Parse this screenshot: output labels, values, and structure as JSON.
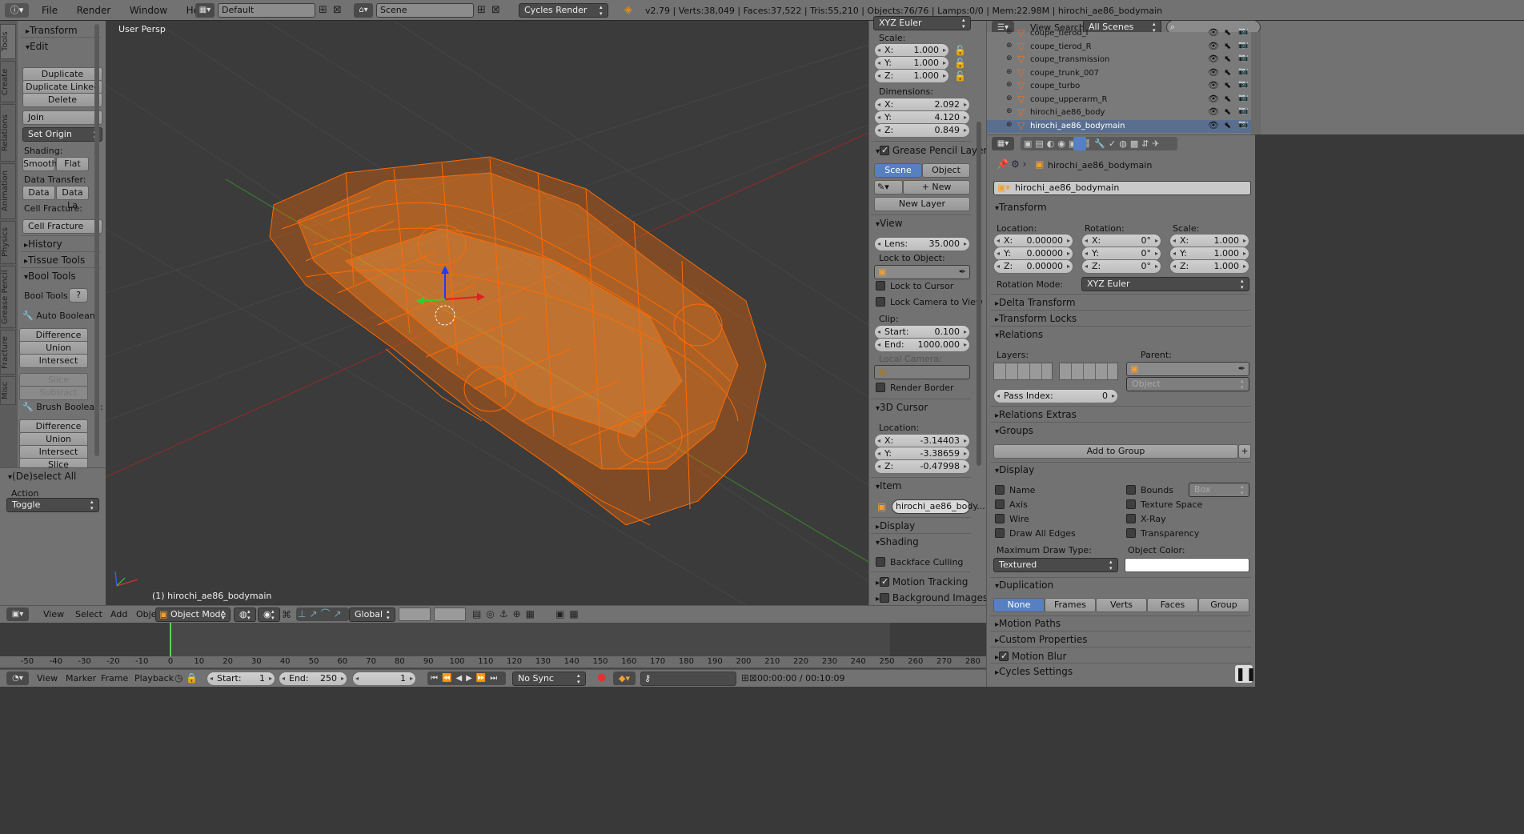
{
  "topbar": {
    "menus": [
      "File",
      "Render",
      "Window",
      "Help"
    ],
    "layout": "Default",
    "scene": "Scene",
    "engine": "Cycles Render",
    "stats": "v2.79 | Verts:38,049 | Faces:37,522 | Tris:55,210 | Objects:76/76 | Lamps:0/0 | Mem:22.98M | hirochi_ae86_bodymain"
  },
  "vtabs": [
    "Tools",
    "Create",
    "Relations",
    "Animation",
    "Physics",
    "Grease Pencil",
    "Fracture",
    "Misc"
  ],
  "tools": {
    "transform": "Transform",
    "edit": "Edit",
    "duplicate": "Duplicate",
    "duplicate_linked": "Duplicate Linked",
    "delete": "Delete",
    "join": "Join",
    "set_origin": "Set Origin",
    "shading": "Shading:",
    "smooth": "Smooth",
    "flat": "Flat",
    "data_transfer": "Data Transfer:",
    "data": "Data",
    "data_la": "Data La",
    "cell_fracture_lbl": "Cell Fracture:",
    "cell_fracture": "Cell Fracture",
    "history": "History",
    "tissue": "Tissue Tools",
    "bool": "Bool Tools",
    "bool_tools": "Bool Tools:",
    "auto_boolean": "Auto Boolean:",
    "difference": "Difference",
    "union": "Union",
    "intersect": "Intersect",
    "slice": "Slice",
    "subtract": "Subtract",
    "brush_boolean": "Brush Boolean:",
    "difference2": "Difference",
    "union2": "Union",
    "intersect2": "Intersect",
    "slice2": "Slice"
  },
  "operator": {
    "title": "(De)select All",
    "action_lbl": "Action",
    "action": "Toggle"
  },
  "viewport": {
    "persp": "User Persp",
    "object": "(1) hirochi_ae86_bodymain"
  },
  "view_header": {
    "view": "View",
    "select": "Select",
    "add": "Add",
    "object": "Object",
    "mode": "Object Mode",
    "orientation": "Global"
  },
  "npanel": {
    "rotmode": "XYZ Euler",
    "scale_lbl": "Scale:",
    "scale": [
      {
        "a": "X:",
        "v": "1.000"
      },
      {
        "a": "Y:",
        "v": "1.000"
      },
      {
        "a": "Z:",
        "v": "1.000"
      }
    ],
    "dim_lbl": "Dimensions:",
    "dims": [
      {
        "a": "X:",
        "v": "2.092"
      },
      {
        "a": "Y:",
        "v": "4.120"
      },
      {
        "a": "Z:",
        "v": "0.849"
      }
    ],
    "gp": "Grease Pencil Layers",
    "gp_scene": "Scene",
    "gp_object": "Object",
    "gp_new": "New",
    "gp_newlayer": "New Layer",
    "view": "View",
    "lens_l": "Lens:",
    "lens_v": "35.000",
    "lock_obj": "Lock to Object:",
    "lock_cursor": "Lock to Cursor",
    "lock_cam": "Lock Camera to View",
    "clip": "Clip:",
    "clip_start_l": "Start:",
    "clip_start_v": "0.100",
    "clip_end_l": "End:",
    "clip_end_v": "1000.000",
    "local_cam": "Local Camera:",
    "render_border": "Render Border",
    "cursor": "3D Cursor",
    "cursor_loc": "Location:",
    "cursor_vals": [
      {
        "a": "X:",
        "v": "-3.14403"
      },
      {
        "a": "Y:",
        "v": "-3.38659"
      },
      {
        "a": "Z:",
        "v": "-0.47998"
      }
    ],
    "item": "Item",
    "item_name": "hirochi_ae86_body...",
    "display": "Display",
    "shading": "Shading",
    "backface": "Backface Culling",
    "motion_tracking": "Motion Tracking",
    "bg_images": "Background Images"
  },
  "outliner": {
    "view": "View",
    "search": "Search",
    "scenes": "All Scenes",
    "items": [
      "coupe_tierod_l",
      "coupe_tierod_R",
      "coupe_transmission",
      "coupe_trunk_007",
      "coupe_turbo",
      "coupe_upperarm_R",
      "hirochi_ae86_body",
      "hirochi_ae86_bodymain"
    ]
  },
  "props": {
    "path_obj": "hirochi_ae86_bodymain",
    "name": "hirochi_ae86_bodymain",
    "transform": "Transform",
    "location": "Location:",
    "rotation": "Rotation:",
    "scale": "Scale:",
    "loc": [
      {
        "a": "X:",
        "v": "0.00000"
      },
      {
        "a": "Y:",
        "v": "0.00000"
      },
      {
        "a": "Z:",
        "v": "0.00000"
      }
    ],
    "rot": [
      {
        "a": "X:",
        "v": "0°"
      },
      {
        "a": "Y:",
        "v": "0°"
      },
      {
        "a": "Z:",
        "v": "0°"
      }
    ],
    "scl": [
      {
        "a": "X:",
        "v": "1.000"
      },
      {
        "a": "Y:",
        "v": "1.000"
      },
      {
        "a": "Z:",
        "v": "1.000"
      }
    ],
    "rotmode_lbl": "Rotation Mode:",
    "rotmode": "XYZ Euler",
    "delta": "Delta Transform",
    "locks": "Transform Locks",
    "relations": "Relations",
    "layers": "Layers:",
    "parent": "Parent:",
    "parent_type": "Object",
    "pass_index_l": "Pass Index:",
    "pass_index_v": "0",
    "rel_extras": "Relations Extras",
    "groups": "Groups",
    "add_group": "Add to Group",
    "display": "Display",
    "d_name": "Name",
    "d_axis": "Axis",
    "d_wire": "Wire",
    "d_drawall": "Draw All Edges",
    "d_bounds": "Bounds",
    "d_box": "Box",
    "d_texspace": "Texture Space",
    "d_xray": "X-Ray",
    "d_transp": "Transparency",
    "max_draw": "Maximum Draw Type:",
    "obj_color": "Object Color:",
    "draw_type": "Textured",
    "duplication": "Duplication",
    "dup_none": "None",
    "dup_frames": "Frames",
    "dup_verts": "Verts",
    "dup_faces": "Faces",
    "dup_group": "Group",
    "motion_paths": "Motion Paths",
    "custom_props": "Custom Properties",
    "motion_blur": "Motion Blur",
    "cycles": "Cycles Settings"
  },
  "timeline": {
    "ticks": [
      "-50",
      "-40",
      "-30",
      "-20",
      "-10",
      "0",
      "10",
      "20",
      "30",
      "40",
      "50",
      "60",
      "70",
      "80",
      "90",
      "100",
      "110",
      "120",
      "130",
      "140",
      "150",
      "160",
      "170",
      "180",
      "190",
      "200",
      "210",
      "220",
      "230",
      "240",
      "250",
      "260",
      "270",
      "280"
    ],
    "view": "View",
    "marker": "Marker",
    "frame": "Frame",
    "playback": "Playback",
    "start_l": "Start:",
    "start_v": "1",
    "end_l": "End:",
    "end_v": "250",
    "cur": "1",
    "sync": "No Sync",
    "time": "00:00:00 / 00:10:09"
  },
  "colors": {
    "wire": "#ff6a00",
    "active": "#5680c2"
  }
}
